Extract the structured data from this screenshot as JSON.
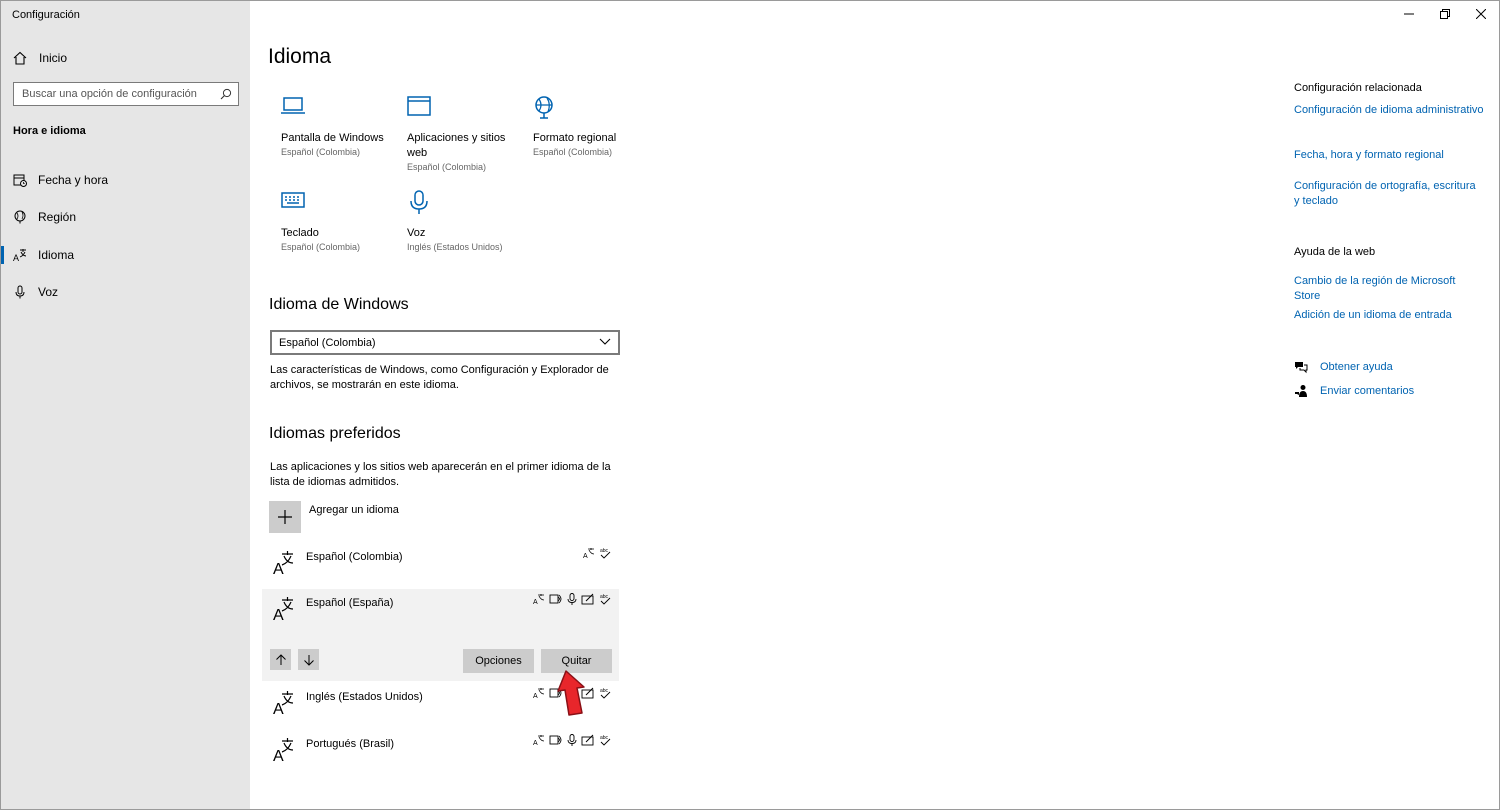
{
  "window": {
    "title": "Configuración"
  },
  "sidebar": {
    "home_label": "Inicio",
    "search_placeholder": "Buscar una opción de configuración",
    "section_heading": "Hora e idioma",
    "items": [
      {
        "label": "Fecha y hora",
        "icon": "calendar-clock-icon"
      },
      {
        "label": "Región",
        "icon": "globe-icon"
      },
      {
        "label": "Idioma",
        "icon": "language-icon",
        "active": true
      },
      {
        "label": "Voz",
        "icon": "microphone-icon"
      }
    ]
  },
  "main": {
    "title": "Idioma",
    "tiles": [
      {
        "name": "Pantalla de Windows",
        "sub": "Español (Colombia)",
        "icon": "laptop-icon"
      },
      {
        "name": "Aplicaciones y sitios web",
        "sub": "Español (Colombia)",
        "icon": "window-icon"
      },
      {
        "name": "Formato regional",
        "sub": "Español (Colombia)",
        "icon": "globe-icon"
      },
      {
        "name": "Teclado",
        "sub": "Español (Colombia)",
        "icon": "keyboard-icon"
      },
      {
        "name": "Voz",
        "sub": "Inglés (Estados Unidos)",
        "icon": "microphone-icon"
      }
    ],
    "windows_language": {
      "heading": "Idioma de Windows",
      "selected": "Español (Colombia)",
      "description": "Las características de Windows, como Configuración y Explorador de archivos, se mostrarán en este idioma."
    },
    "preferred": {
      "heading": "Idiomas preferidos",
      "description": "Las aplicaciones y los sitios web aparecerán en el primer idioma de la lista de idiomas admitidos.",
      "add_label": "Agregar un idioma",
      "languages": [
        {
          "name": "Español (Colombia)"
        },
        {
          "name": "Español (España)",
          "selected": true
        },
        {
          "name": "Inglés (Estados Unidos)"
        },
        {
          "name": "Portugués (Brasil)"
        }
      ],
      "options_label": "Opciones",
      "remove_label": "Quitar"
    }
  },
  "right": {
    "related_heading": "Configuración relacionada",
    "related_links": [
      "Configuración de idioma administrativo",
      "Fecha, hora y formato regional",
      "Configuración de ortografía, escritura y teclado"
    ],
    "web_help_heading": "Ayuda de la web",
    "web_links": [
      "Cambio de la región de Microsoft Store",
      "Adición de un idioma de entrada"
    ],
    "get_help": "Obtener ayuda",
    "feedback": "Enviar comentarios"
  },
  "colors": {
    "accent": "#0063b1",
    "sidebar_bg": "#e6e6e6",
    "button_bg": "#cccccc",
    "pointer": "#e8262b"
  }
}
